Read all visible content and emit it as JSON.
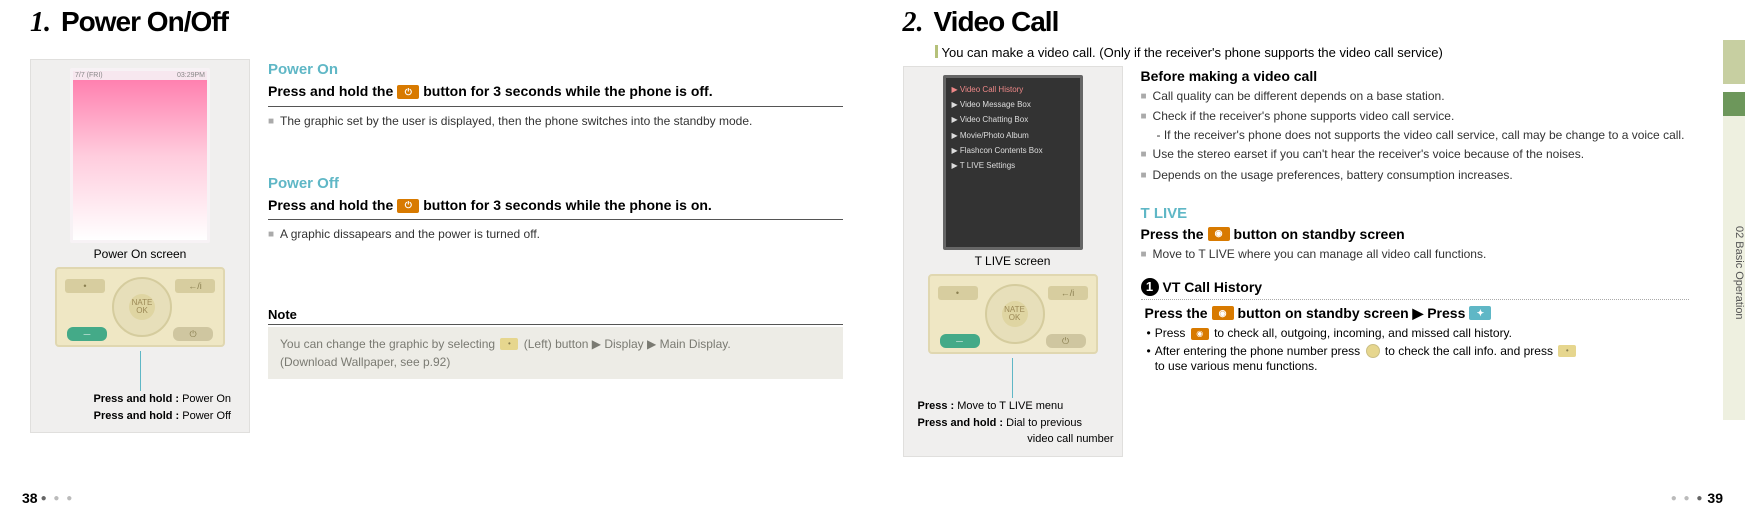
{
  "left": {
    "num": "1.",
    "title": "Power On/Off",
    "screen_caption": "Power On screen",
    "screen_top_left": "7/7 (FRI)",
    "screen_top_right": "03:29PM",
    "key_notes": [
      {
        "bold": "Press and hold : ",
        "rest": "Power On"
      },
      {
        "bold": "Press and hold : ",
        "rest": "Power Off"
      }
    ],
    "power_on": {
      "heading": "Power On",
      "instr_pre": "Press and hold the",
      "instr_post": "button for 3 seconds while the phone is off.",
      "bullets": [
        "The graphic set by the user is displayed, then the phone switches into the standby mode."
      ]
    },
    "power_off": {
      "heading": "Power Off",
      "instr_pre": "Press and hold the",
      "instr_post": "button for 3 seconds while the phone is on.",
      "bullets": [
        "A graphic dissapears and the power is turned off."
      ]
    },
    "note_label": "Note",
    "note_pre": "You can change the graphic by selecting",
    "note_post": "(Left) button ▶ Display ▶ Main Display.",
    "note_line2": "(Download Wallpaper, see p.92)",
    "page_num": "38"
  },
  "right": {
    "num": "2.",
    "title": "Video Call",
    "intro": "You can make a video call. (Only if the receiver's phone supports the video call service)",
    "screen_caption": "T LIVE screen",
    "menu_items": [
      "Video Call History",
      "Video Message Box",
      "Video Chatting Box",
      "Movie/Photo Album",
      "Flashcon Contents Box",
      "T LIVE Settings"
    ],
    "key_notes": [
      {
        "bold": "Press : ",
        "rest": "Move to T LIVE menu"
      },
      {
        "bold": "Press and hold : ",
        "rest": "Dial to previous"
      },
      {
        "bold": "",
        "rest": "video call number"
      }
    ],
    "before": {
      "heading": "Before making a video call",
      "bullets": [
        "Call quality can be different depends on a base station.",
        "Check if the receiver's phone supports video call service.",
        "Use the stereo earset if you can't hear the receiver's voice because of the noises.",
        "Depends on the usage preferences, battery consumption increases."
      ],
      "sub_bullet": "- If the receiver's phone does not supports the video call service, call may be change to a voice call."
    },
    "tlive": {
      "heading": "T LIVE",
      "instr_pre": "Press the",
      "instr_post": "button on standby screen",
      "bullets": [
        "Move to T LIVE where you can manage all video call functions."
      ]
    },
    "vt": {
      "num": "1",
      "heading": "VT Call History",
      "instr_pre": "Press the",
      "instr_mid": "button on standby screen ▶ Press",
      "dots": [
        {
          "pre": "Press",
          "post": "to check all, outgoing, incoming, and missed call history."
        },
        {
          "pre": "After entering the phone number press",
          "mid": "to check the call info. and press",
          "post": "to use various menu functions."
        }
      ]
    },
    "side_tab": "02  Basic Operation",
    "page_num": "39"
  },
  "keypad_center": "NATE OK"
}
